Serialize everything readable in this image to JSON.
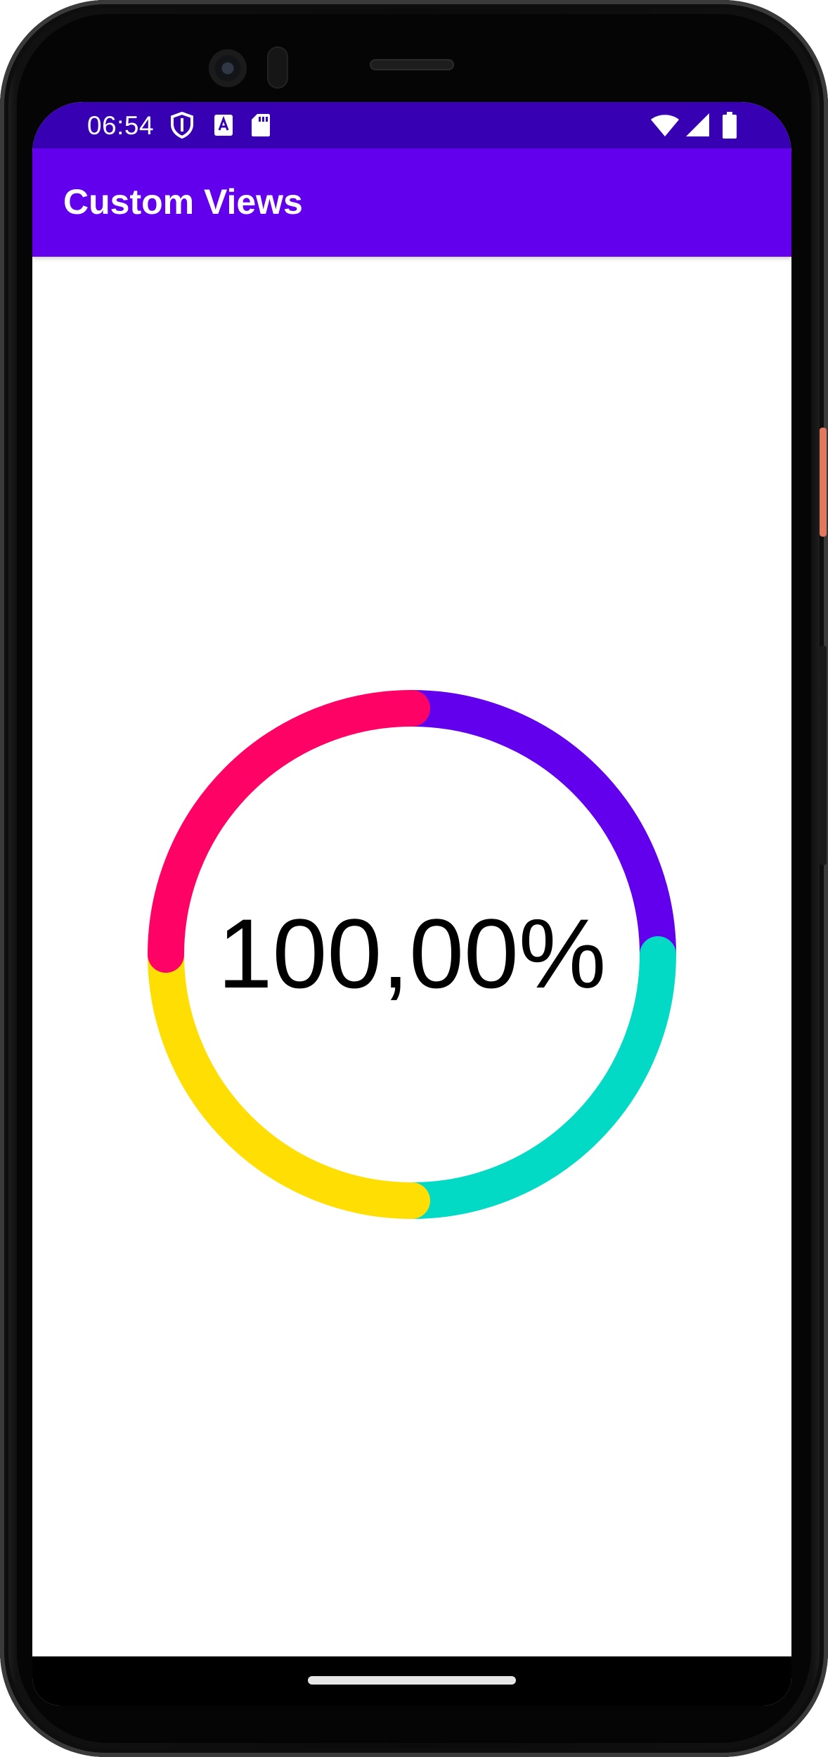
{
  "status_bar": {
    "time": "06:54",
    "left_icons": [
      "shield-icon",
      "text-a-icon",
      "sd-card-icon"
    ],
    "right_icons": [
      "wifi-icon",
      "signal-icon",
      "battery-icon"
    ]
  },
  "app_bar": {
    "title": "Custom Views",
    "color": "#6200ee",
    "status_color": "#3700b3"
  },
  "progress_view": {
    "label": "100,00%",
    "progress_percent": 100,
    "segments": [
      {
        "color": "#6200ee",
        "start_angle": 0,
        "end_angle": 90
      },
      {
        "color": "#03dac5",
        "start_angle": 90,
        "end_angle": 180
      },
      {
        "color": "#ffde03",
        "start_angle": 180,
        "end_angle": 270
      },
      {
        "color": "#ff0266",
        "start_angle": 270,
        "end_angle": 360
      }
    ]
  }
}
